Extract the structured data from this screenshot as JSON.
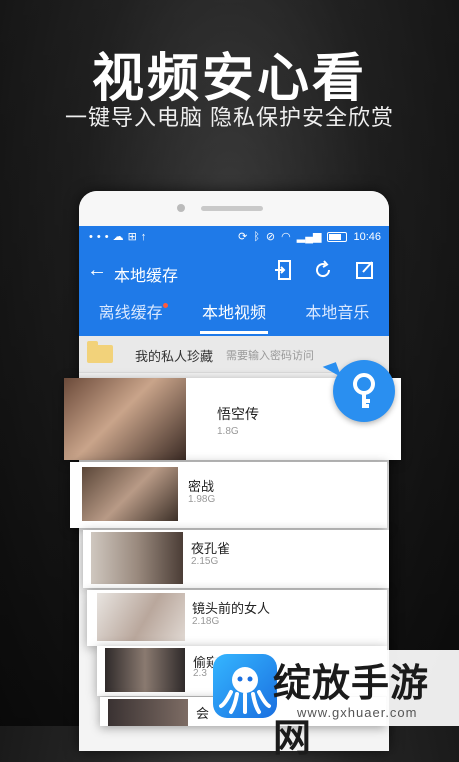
{
  "hero": {
    "title": "视频安心看",
    "subtitle": "一键导入电脑  隐私保护安全欣赏"
  },
  "statusbar": {
    "left_icons": [
      "dots-icon",
      "cloud-icon",
      "grid-icon",
      "upload-icon"
    ],
    "right_icons": [
      "sync-icon",
      "bluetooth-icon",
      "mute-icon",
      "wifi-icon",
      "signal-icon",
      "battery-icon"
    ],
    "time": "10:46"
  },
  "appbar": {
    "title": "本地缓存",
    "back_icon": "arrow-left-icon",
    "actions": [
      "import-icon",
      "refresh-icon",
      "edit-icon"
    ]
  },
  "tabs": [
    {
      "label": "离线缓存",
      "active": false,
      "badge": true
    },
    {
      "label": "本地视频",
      "active": true,
      "badge": false
    },
    {
      "label": "本地音乐",
      "active": false,
      "badge": false
    }
  ],
  "folder": {
    "name": "我的私人珍藏",
    "hint": "需要输入密码访问"
  },
  "videos": [
    {
      "name": "悟空传",
      "size": "1.8G"
    },
    {
      "name": "密战",
      "size": "1.98G"
    },
    {
      "name": "夜孔雀",
      "size": "2.15G"
    },
    {
      "name": "镜头前的女人",
      "size": "2.18G"
    },
    {
      "name": "偷窥者",
      "size": "2.3"
    },
    {
      "name": "会",
      "size": ""
    }
  ],
  "watermark": {
    "brand": "绽放手游网",
    "url": "www.gxhuaer.com"
  },
  "colors": {
    "app_blue": "#1f7ae8",
    "key_blue": "#2a8ff0",
    "badge_red": "#ff5a3c"
  }
}
